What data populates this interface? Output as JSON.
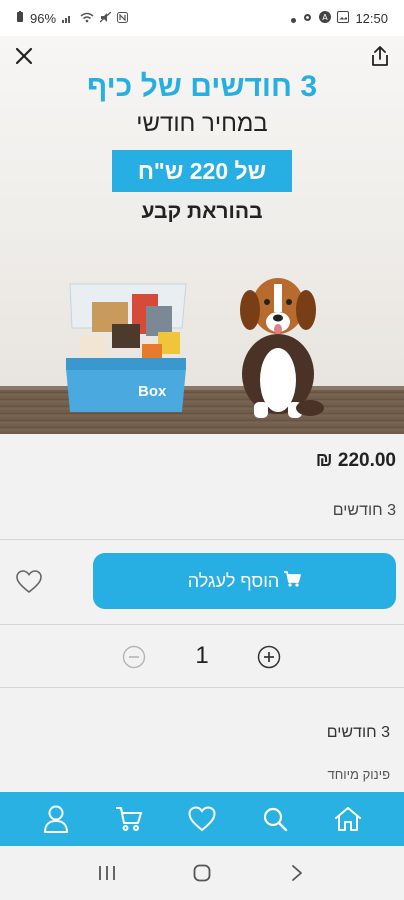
{
  "status_bar": {
    "battery": "96%",
    "time": "12:50"
  },
  "hero": {
    "promo_title": "3 חודשים של כיף",
    "promo_subtitle": "במחיר חודשי",
    "promo_price": "של 220 ש\"ח",
    "promo_standing_order": "בהוראת קבע",
    "box_brand": "Box"
  },
  "product": {
    "price": "220.00 ₪",
    "variant": "3 חודשים",
    "add_to_cart_label": "הוסף לעגלה",
    "quantity": "1",
    "description_title": "3 חודשים",
    "description_text": "פינוק מיוחד"
  },
  "bottom_nav": {
    "items": [
      "account-icon",
      "cart-icon",
      "favorites-icon",
      "search-icon",
      "home-icon"
    ]
  },
  "colors": {
    "accent": "#27aee2",
    "nav_bar": "#29b1e4",
    "background": "#f2f2f2"
  }
}
